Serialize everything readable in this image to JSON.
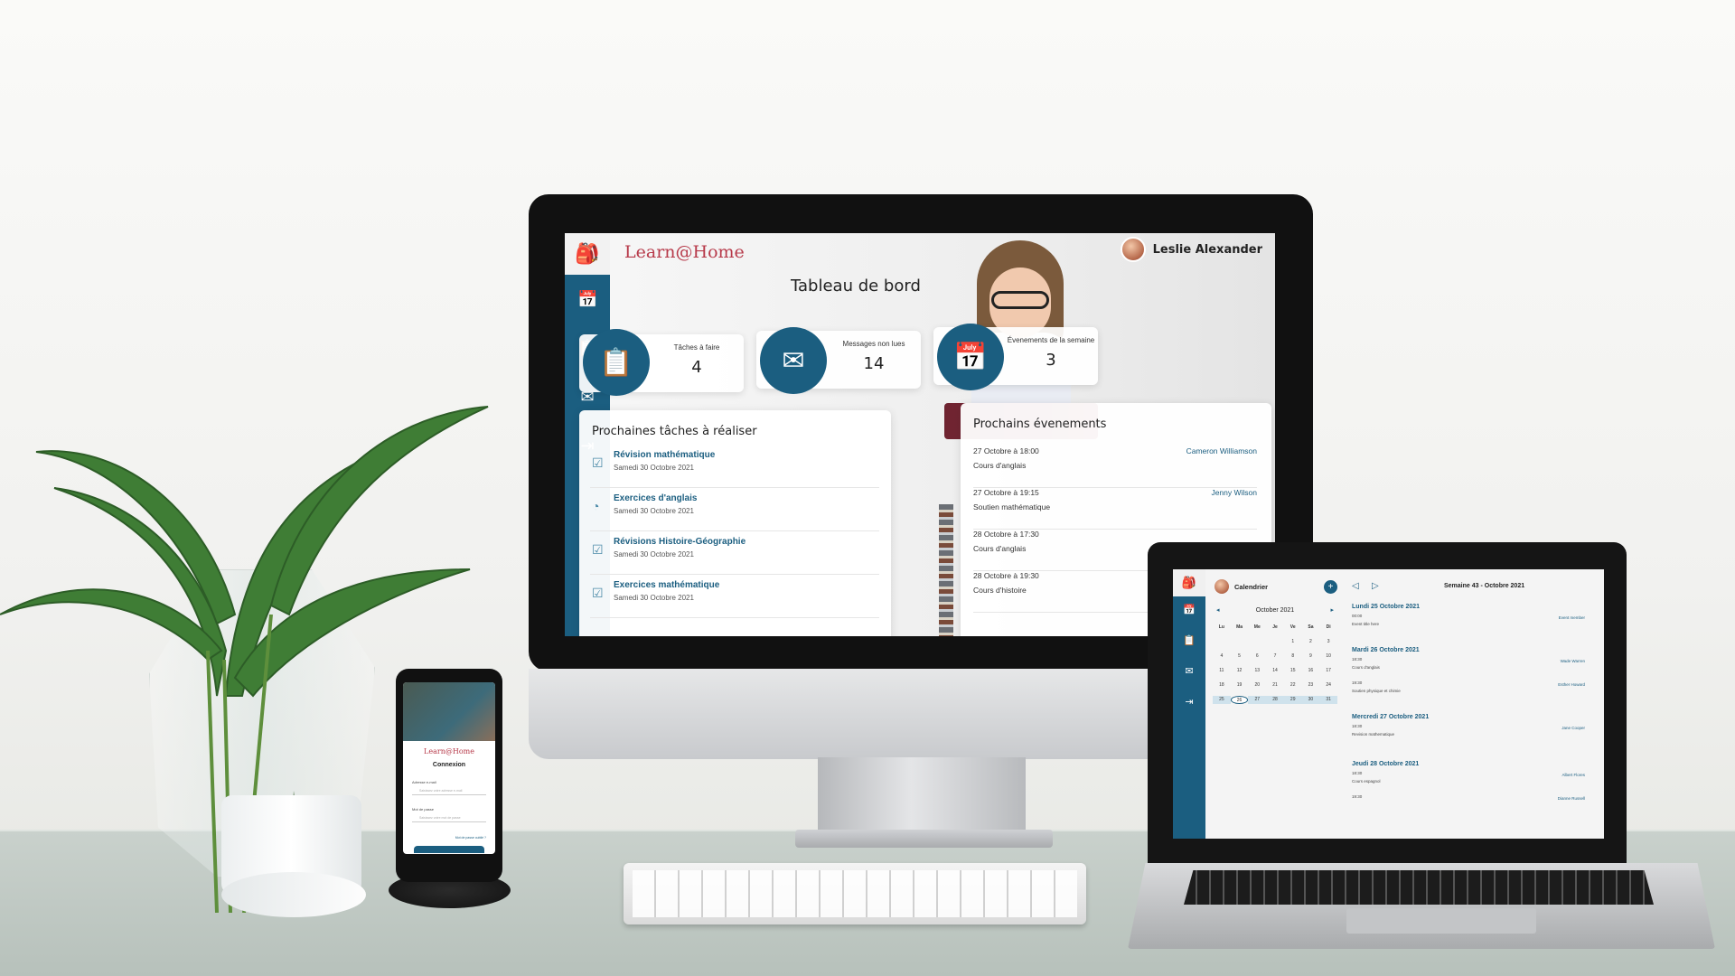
{
  "desktop": {
    "brand": "Learn@Home",
    "user_name": "Leslie Alexander",
    "page_title": "Tableau de bord",
    "nav_icons": [
      "backpack-icon",
      "calendar-icon",
      "clipboard-check-icon",
      "mail-icon",
      "logout-icon"
    ],
    "stats": [
      {
        "label": "Tâches à faire",
        "value": "4",
        "icon": "clipboard-check-icon"
      },
      {
        "label": "Messages non lues",
        "value": "14",
        "icon": "mail-icon"
      },
      {
        "label": "Évenements de la semaine",
        "value": "3",
        "icon": "calendar-icon"
      }
    ],
    "tasks_panel": {
      "title": "Prochaines tâches à réaliser",
      "items": [
        {
          "title": "Révision mathématique",
          "date": "Samedi 30 Octobre 2021",
          "icon": "checkbox-icon"
        },
        {
          "title": "Exercices d'anglais",
          "date": "Samedi 30 Octobre 2021",
          "icon": "progress-icon"
        },
        {
          "title": "Révisions Histoire-Géographie",
          "date": "Samedi 30 Octobre 2021",
          "icon": "checkbox-icon"
        },
        {
          "title": "Exercices mathématique",
          "date": "Samedi 30 Octobre 2021",
          "icon": "checkbox-icon"
        }
      ]
    },
    "events_panel": {
      "title": "Prochains évenements",
      "items": [
        {
          "when": "27 Octobre à 18:00",
          "what": "Cours d'anglais",
          "who": "Cameron Williamson"
        },
        {
          "when": "27 Octobre à 19:15",
          "what": "Soutien mathématique",
          "who": "Jenny Wilson"
        },
        {
          "when": "28 Octobre à 17:30",
          "what": "Cours d'anglais",
          "who": ""
        },
        {
          "when": "28 Octobre à 19:30",
          "what": "Cours d'histoire",
          "who": ""
        }
      ]
    }
  },
  "phone": {
    "brand": "Learn@Home",
    "heading": "Connexion",
    "email_label": "Adresse e-mail",
    "email_placeholder": "Saisissez votre adresse e-mail",
    "password_label": "Mot de passe",
    "password_placeholder": "Saisissez votre mot de passe",
    "forgot_link": "Mot de passe oublié ?"
  },
  "laptop": {
    "title": "Calendrier",
    "add_label": "+",
    "prev_label": "◁",
    "next_label": "▷",
    "week_label": "Semaine 43 - Octobre 2021",
    "calendar": {
      "month": "October 2021",
      "prev": "◂",
      "next": "▸",
      "weekdays": [
        "Lu",
        "Ma",
        "Me",
        "Je",
        "Ve",
        "Sa",
        "Di"
      ],
      "weeks": [
        [
          "",
          "",
          "",
          "",
          "1",
          "2",
          "3"
        ],
        [
          "4",
          "5",
          "6",
          "7",
          "8",
          "9",
          "10"
        ],
        [
          "11",
          "12",
          "13",
          "14",
          "15",
          "16",
          "17"
        ],
        [
          "18",
          "19",
          "20",
          "21",
          "22",
          "23",
          "24"
        ],
        [
          "25",
          "26",
          "27",
          "28",
          "29",
          "30",
          "31"
        ]
      ],
      "today": "26"
    },
    "days": [
      {
        "title": "Lundi 25 Octobre 2021",
        "slots": [
          {
            "time": "00:00",
            "desc": "Event title here",
            "who": "Event member"
          }
        ]
      },
      {
        "title": "Mardi 26 Octobre 2021",
        "slots": [
          {
            "time": "18:30",
            "desc": "Cours d'anglais",
            "who": "Wade Warren"
          },
          {
            "time": "19:30",
            "desc": "Soutien physique et chimie",
            "who": "Esther Howard"
          }
        ]
      },
      {
        "title": "Mercredi 27 Octobre 2021",
        "slots": [
          {
            "time": "18:30",
            "desc": "Revision mathematique",
            "who": "Jane Cooper"
          }
        ]
      },
      {
        "title": "Jeudi 28 Octobre 2021",
        "slots": [
          {
            "time": "18:30",
            "desc": "Cours espagnol",
            "who": "Albert Flores"
          },
          {
            "time": "19:30",
            "desc": "",
            "who": "Dianne Russell"
          }
        ]
      }
    ]
  },
  "colors": {
    "primary": "#1b5e80",
    "brand": "#b73a4a"
  }
}
